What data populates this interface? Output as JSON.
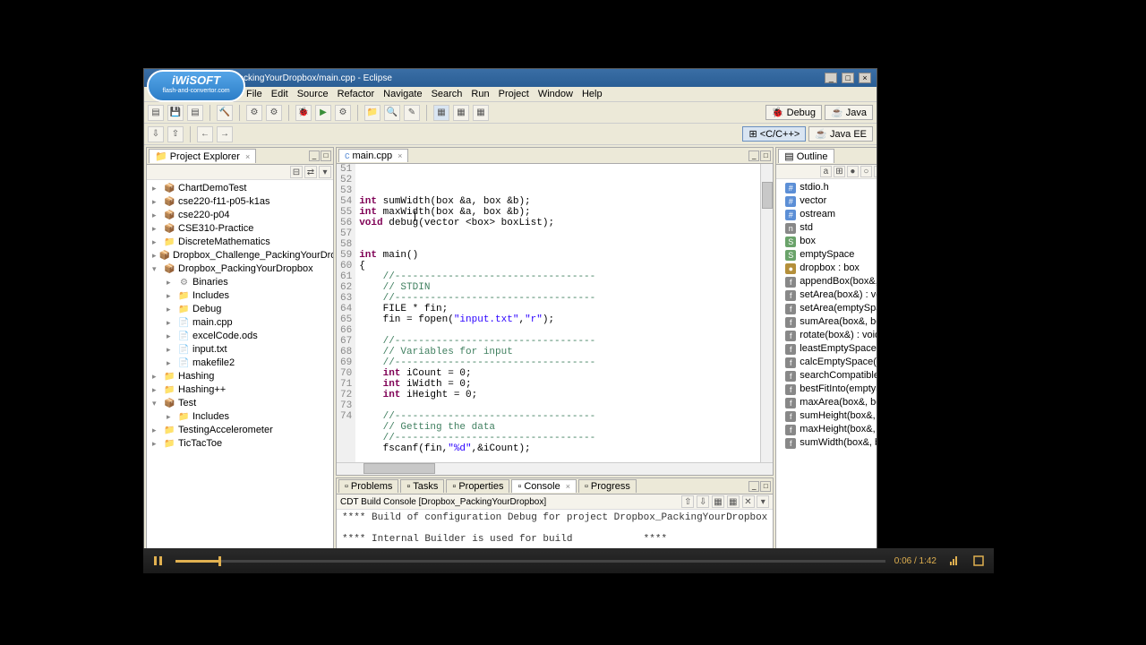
{
  "window": {
    "title": "<C/C++> - Dropbox_PackingYourDropbox/main.cpp - Eclipse"
  },
  "badge": {
    "title": "iWiSOFT",
    "sub": "flash-and-convertor.com"
  },
  "menu": [
    "File",
    "Edit",
    "Source",
    "Refactor",
    "Navigate",
    "Search",
    "Run",
    "Project",
    "Window",
    "Help"
  ],
  "perspectives": {
    "debug": "Debug",
    "java": "Java",
    "cpp": "<C/C++>",
    "javaee": "Java EE"
  },
  "explorer": {
    "title": "Project Explorer",
    "items": [
      {
        "i": "cproj",
        "l": 0,
        "t": "",
        "n": "ChartDemoTest"
      },
      {
        "i": "cproj",
        "l": 0,
        "t": "",
        "n": "cse220-f11-p05-k1as"
      },
      {
        "i": "cproj",
        "l": 0,
        "t": "",
        "n": "cse220-p04"
      },
      {
        "i": "cproj",
        "l": 0,
        "t": "",
        "n": "CSE310-Practice"
      },
      {
        "i": "folder",
        "l": 0,
        "t": "",
        "n": "DiscreteMathematics"
      },
      {
        "i": "cproj",
        "l": 0,
        "t": "",
        "n": "Dropbox_Challenge_PackingYourDropt"
      },
      {
        "i": "cproj",
        "l": 0,
        "t": "▾",
        "n": "Dropbox_PackingYourDropbox"
      },
      {
        "i": "bin",
        "l": 1,
        "t": "",
        "n": "Binaries"
      },
      {
        "i": "folder",
        "l": 1,
        "t": "",
        "n": "Includes"
      },
      {
        "i": "folder",
        "l": 1,
        "t": "",
        "n": "Debug"
      },
      {
        "i": "file",
        "l": 1,
        "t": "",
        "n": "main.cpp"
      },
      {
        "i": "file",
        "l": 1,
        "t": "",
        "n": "excelCode.ods"
      },
      {
        "i": "file",
        "l": 1,
        "t": "",
        "n": "input.txt"
      },
      {
        "i": "file",
        "l": 1,
        "t": "",
        "n": "makefile2"
      },
      {
        "i": "folder",
        "l": 0,
        "t": "",
        "n": "Hashing"
      },
      {
        "i": "folder",
        "l": 0,
        "t": "",
        "n": "Hashing++"
      },
      {
        "i": "cproj",
        "l": 0,
        "t": "▾",
        "n": "Test"
      },
      {
        "i": "folder",
        "l": 1,
        "t": "",
        "n": "Includes"
      },
      {
        "i": "folder",
        "l": 0,
        "t": "",
        "n": "TestingAccelerometer"
      },
      {
        "i": "folder",
        "l": 0,
        "t": "",
        "n": "TicTacToe"
      }
    ]
  },
  "editor": {
    "tab": "main.cpp",
    "first_line_no": 51,
    "lines": [
      {
        "n": 51,
        "html": "<span class='kw'>int</span> <span class='fn'>sumWidth</span>(box &a, box &b);"
      },
      {
        "n": 52,
        "html": "<span class='kw'>int</span> <span class='fn'>maxWidth</span>(box &a, box &b);"
      },
      {
        "n": 53,
        "html": "<span class='kw'>void</span> <span class='fn'>debug</span>(vector &lt;box&gt; boxList);"
      },
      {
        "n": 54,
        "html": ""
      },
      {
        "n": 55,
        "html": ""
      },
      {
        "n": 56,
        "html": "<span class='kw'>int</span> <span class='fn'>main</span>()"
      },
      {
        "n": 57,
        "html": "{"
      },
      {
        "n": 58,
        "html": "    <span class='cm'>//----------------------------------</span>"
      },
      {
        "n": 59,
        "html": "    <span class='cm'>// STDIN</span>"
      },
      {
        "n": 60,
        "html": "    <span class='cm'>//----------------------------------</span>"
      },
      {
        "n": 61,
        "html": "    FILE * fin;"
      },
      {
        "n": 62,
        "html": "    fin = fopen(<span class='st'>\"input.txt\"</span>,<span class='st'>\"r\"</span>);"
      },
      {
        "n": 63,
        "html": ""
      },
      {
        "n": 64,
        "html": "    <span class='cm'>//----------------------------------</span>"
      },
      {
        "n": 65,
        "html": "    <span class='cm'>// Variables for input</span>"
      },
      {
        "n": 66,
        "html": "    <span class='cm'>//----------------------------------</span>"
      },
      {
        "n": 67,
        "html": "    <span class='kw'>int</span> iCount = 0;"
      },
      {
        "n": 68,
        "html": "    <span class='kw'>int</span> iWidth = 0;"
      },
      {
        "n": 69,
        "html": "    <span class='kw'>int</span> iHeight = 0;"
      },
      {
        "n": 70,
        "html": ""
      },
      {
        "n": 71,
        "html": "    <span class='cm'>//----------------------------------</span>"
      },
      {
        "n": 72,
        "html": "    <span class='cm'>// Getting the data</span>"
      },
      {
        "n": 73,
        "html": "    <span class='cm'>//----------------------------------</span>"
      },
      {
        "n": 74,
        "html": "    fscanf(fin,<span class='st'>\"%d\"</span>,&iCount);"
      }
    ]
  },
  "outline": {
    "title": "Outline",
    "items": [
      {
        "t": "inc",
        "n": "stdio.h"
      },
      {
        "t": "inc",
        "n": "vector"
      },
      {
        "t": "inc",
        "n": "ostream"
      },
      {
        "t": "ns",
        "n": "std"
      },
      {
        "t": "struct",
        "n": "box"
      },
      {
        "t": "struct",
        "n": "emptySpace"
      },
      {
        "t": "var",
        "n": "dropbox : box"
      },
      {
        "t": "fn",
        "n": "appendBox(box&, bo"
      },
      {
        "t": "fn",
        "n": "setArea(box&) : void"
      },
      {
        "t": "fn",
        "n": "setArea(emptySpace&"
      },
      {
        "t": "fn",
        "n": "sumArea(box&, box&"
      },
      {
        "t": "fn",
        "n": "rotate(box&) : void"
      },
      {
        "t": "fn",
        "n": "leastEmptySpaceApp"
      },
      {
        "t": "fn",
        "n": "calcEmptySpace(box&"
      },
      {
        "t": "fn",
        "n": "searchCompatibleBo"
      },
      {
        "t": "fn",
        "n": "bestFitInto(emptySpa"
      },
      {
        "t": "fn",
        "n": "maxArea(box&, box&"
      },
      {
        "t": "fn",
        "n": "sumHeight(box&, bo"
      },
      {
        "t": "fn",
        "n": "maxHeight(box&, bo"
      },
      {
        "t": "fn",
        "n": "sumWidth(box&, box"
      }
    ]
  },
  "bottom": {
    "tabs": [
      "Problems",
      "Tasks",
      "Properties",
      "Console",
      "Progress"
    ],
    "active": "Console",
    "console_title": "CDT Build Console [Dropbox_PackingYourDropbox]",
    "console_text": "**** Build of configuration Debug for project Dropbox_PackingYourDropbox\n\n**** Internal Builder is used for build            ****"
  },
  "player": {
    "time": "0:06 / 1:42"
  }
}
